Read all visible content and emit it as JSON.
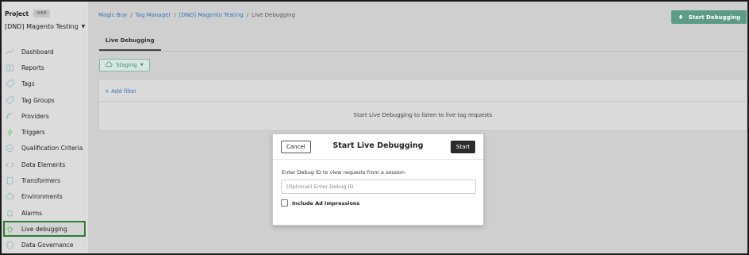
{
  "sidebar": {
    "project_label": "Project",
    "project_badge": "WEB",
    "project_name": "[DND] Magento Testing",
    "items": [
      {
        "label": "Dashboard",
        "icon": "chart-line-icon"
      },
      {
        "label": "Reports",
        "icon": "book-icon"
      },
      {
        "label": "Tags",
        "icon": "tag-icon"
      },
      {
        "label": "Tag Groups",
        "icon": "tags-icon"
      },
      {
        "label": "Providers",
        "icon": "signal-icon"
      },
      {
        "label": "Triggers",
        "icon": "bolt-icon"
      },
      {
        "label": "Qualification Criteria",
        "icon": "check-circle-icon"
      },
      {
        "label": "Data Elements",
        "icon": "code-icon"
      },
      {
        "label": "Transformers",
        "icon": "file-icon"
      },
      {
        "label": "Environments",
        "icon": "cloud-icon"
      },
      {
        "label": "Alarms",
        "icon": "bell-icon"
      },
      {
        "label": "Live debugging",
        "icon": "bug-icon",
        "active": true
      },
      {
        "label": "Data Governance",
        "icon": "shield-icon"
      }
    ]
  },
  "breadcrumb": {
    "items": [
      "Magic Buy",
      "Tag Manager",
      "[DND] Magento Testing"
    ],
    "current": "Live Debugging",
    "separator": "/"
  },
  "header": {
    "start_button": "Start Debugging"
  },
  "tabs": {
    "active": "Live Debugging"
  },
  "toolbar": {
    "environment": "Staging",
    "add_filter": "+ Add filter"
  },
  "panel": {
    "message": "Start Live Debugging to listen to live tag requests"
  },
  "modal": {
    "title": "Start Live Debugging",
    "cancel": "Cancel",
    "start": "Start",
    "label": "Enter Debug ID to view requests from a session",
    "input_placeholder": "(Optional) Enter Debug ID",
    "input_value": "",
    "checkbox_label": "Include Ad Impressions",
    "checkbox_checked": false
  },
  "colors": {
    "accent": "#5c9c86",
    "active_outline": "#2e7d32",
    "link": "#3b73b9"
  }
}
